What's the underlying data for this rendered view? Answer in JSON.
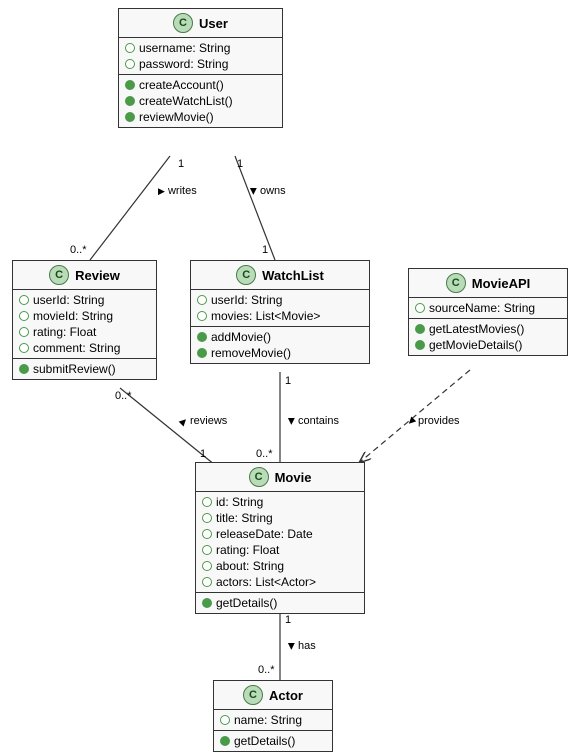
{
  "classes": {
    "user": {
      "name": "User",
      "attrs": [
        "username: String",
        "password: String"
      ],
      "ops": [
        "createAccount()",
        "createWatchList()",
        "reviewMovie()"
      ]
    },
    "review": {
      "name": "Review",
      "attrs": [
        "userId: String",
        "movieId: String",
        "rating: Float",
        "comment: String"
      ],
      "ops": [
        "submitReview()"
      ]
    },
    "watchlist": {
      "name": "WatchList",
      "attrs": [
        "userId: String",
        "movies: List<Movie>"
      ],
      "ops": [
        "addMovie()",
        "removeMovie()"
      ]
    },
    "movieapi": {
      "name": "MovieAPI",
      "attrs": [
        "sourceName: String"
      ],
      "ops": [
        "getLatestMovies()",
        "getMovieDetails()"
      ]
    },
    "movie": {
      "name": "Movie",
      "attrs": [
        "id: String",
        "title: String",
        "releaseDate: Date",
        "rating: Float",
        "about: String",
        "actors: List<Actor>"
      ],
      "ops": [
        "getDetails()"
      ]
    },
    "actor": {
      "name": "Actor",
      "attrs": [
        "name: String"
      ],
      "ops": [
        "getDetails()"
      ]
    }
  },
  "relations": {
    "writes": {
      "label": "writes",
      "src_card": "1",
      "dst_card": "0..*"
    },
    "owns": {
      "label": "owns",
      "src_card": "1",
      "dst_card": "1"
    },
    "reviews": {
      "label": "reviews",
      "src_card": "0..*",
      "dst_card": "1"
    },
    "contains": {
      "label": "contains",
      "src_card": "1",
      "dst_card": "0..*"
    },
    "provides": {
      "label": "provides"
    },
    "has": {
      "label": "has",
      "src_card": "1",
      "dst_card": "0..*"
    }
  }
}
